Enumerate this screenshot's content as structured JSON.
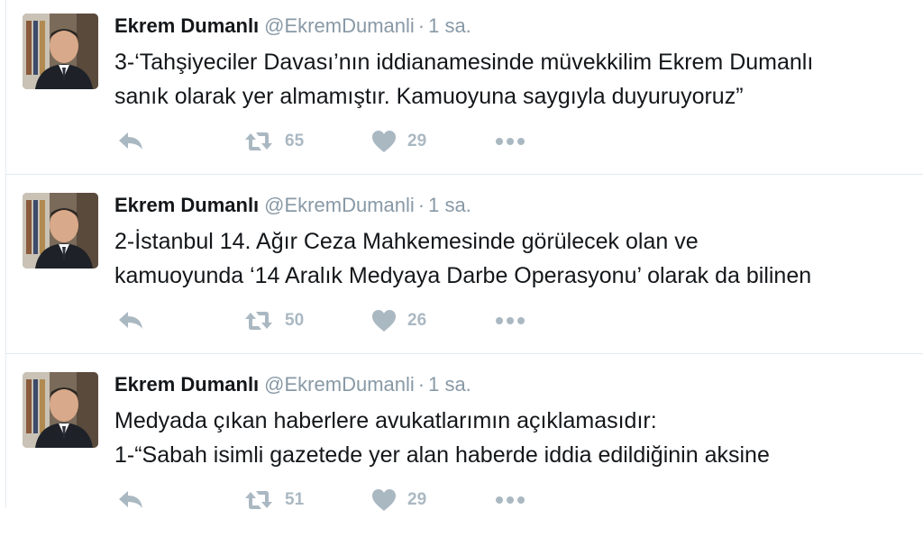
{
  "tweets": [
    {
      "name": "Ekrem Dumanlı",
      "handle": "@EkremDumanli",
      "dot": "·",
      "time": "1 sa.",
      "lines": [
        "3-‘Tahşiyeciler Davası’nın iddianamesinde müvekkilim Ekrem Dumanlı",
        "sanık olarak yer almamıştır. Kamuoyuna saygıyla duyuruyoruz”"
      ],
      "retweets": "65",
      "likes": "29"
    },
    {
      "name": "Ekrem Dumanlı",
      "handle": "@EkremDumanli",
      "dot": "·",
      "time": "1 sa.",
      "lines": [
        "2-İstanbul 14. Ağır Ceza Mahkemesinde görülecek olan ve",
        "kamuoyunda ‘14 Aralık Medyaya Darbe Operasyonu’ olarak da bilinen"
      ],
      "retweets": "50",
      "likes": "26"
    },
    {
      "name": "Ekrem Dumanlı",
      "handle": "@EkremDumanli",
      "dot": "·",
      "time": "1 sa.",
      "lines": [
        "Medyada çıkan haberlere avukatlarımın açıklamasıdır:",
        "1-“Sabah isimli gazetede yer alan haberde iddia edildiğinin aksine"
      ],
      "retweets": "51",
      "likes": "29"
    }
  ],
  "icons": {
    "reply": "reply-icon",
    "retweet": "retweet-icon",
    "like": "heart-icon",
    "more": "more-icon"
  },
  "colors": {
    "text": "#14171a",
    "muted": "#8899a6",
    "icon": "#aab8c2",
    "divider": "#e1e8ed"
  }
}
